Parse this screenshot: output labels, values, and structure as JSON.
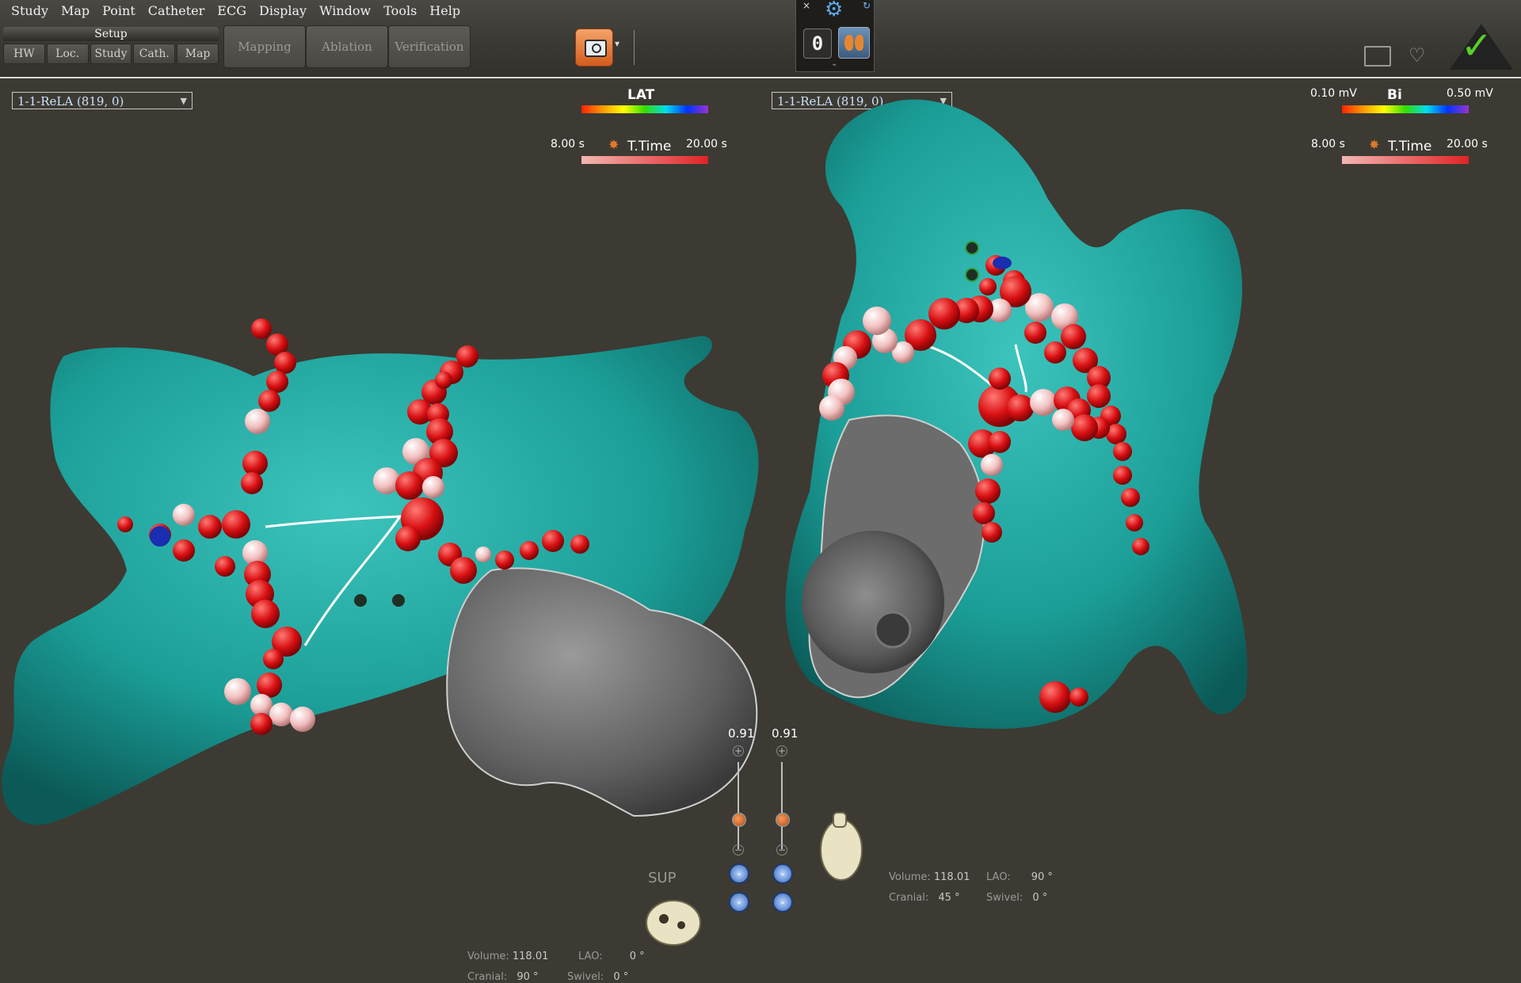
{
  "menu": [
    {
      "label": "Study"
    },
    {
      "label": "Map"
    },
    {
      "label": "Point"
    },
    {
      "label": "Catheter"
    },
    {
      "label": "ECG"
    },
    {
      "label": "Display"
    },
    {
      "label": "Window"
    },
    {
      "label": "Tools"
    },
    {
      "label": "Help"
    }
  ],
  "toolbar": {
    "setup_label": "Setup",
    "setup_tabs": [
      "HW",
      "Loc.",
      "Study",
      "Cath.",
      "Map"
    ],
    "mode_buttons": [
      "Mapping",
      "Ablation",
      "Verification"
    ],
    "snapshot_icon": "camera-icon",
    "respiration_count": "0",
    "respiration_icon": "lungs-icon",
    "close_glyph": "×",
    "gear_glyph": "⚙",
    "refresh_glyph": "↻",
    "ok_glyph": "✓"
  },
  "left_view": {
    "map_name": "1-1-ReLA (819, 0)",
    "legend_title": "LAT",
    "ttime_label": "T.Time",
    "ttime_min": "8.00 s",
    "ttime_max": "20.00 s",
    "orientation": "SUP",
    "volume_label": "Volume:",
    "volume": "118.01",
    "lao_label": "LAO:",
    "lao": "0 °",
    "cranial_label": "Cranial:",
    "cranial": "90 °",
    "swivel_label": "Swivel:",
    "swivel": "0 °",
    "zoom": "0.91"
  },
  "right_view": {
    "map_name": "1-1-ReLA (819, 0)",
    "legend_title": "Bi",
    "bi_min": "0.10 mV",
    "bi_max": "0.50 mV",
    "ttime_label": "T.Time",
    "ttime_min": "8.00 s",
    "ttime_max": "20.00 s",
    "volume_label": "Volume:",
    "volume": "118.01",
    "lao_label": "LAO:",
    "lao": "90 °",
    "cranial_label": "Cranial:",
    "cranial": "45 °",
    "swivel_label": "Swivel:",
    "swivel": "0 °",
    "zoom": "0.91"
  },
  "colors": {
    "anatomy_surface": "#1e9e98",
    "ablation_lesion": "#d80f12",
    "lesion_light": "#f2c0c0",
    "valve_grey": "#6e6e6e",
    "background": "#3c3a33",
    "accept_green": "#58d024"
  }
}
